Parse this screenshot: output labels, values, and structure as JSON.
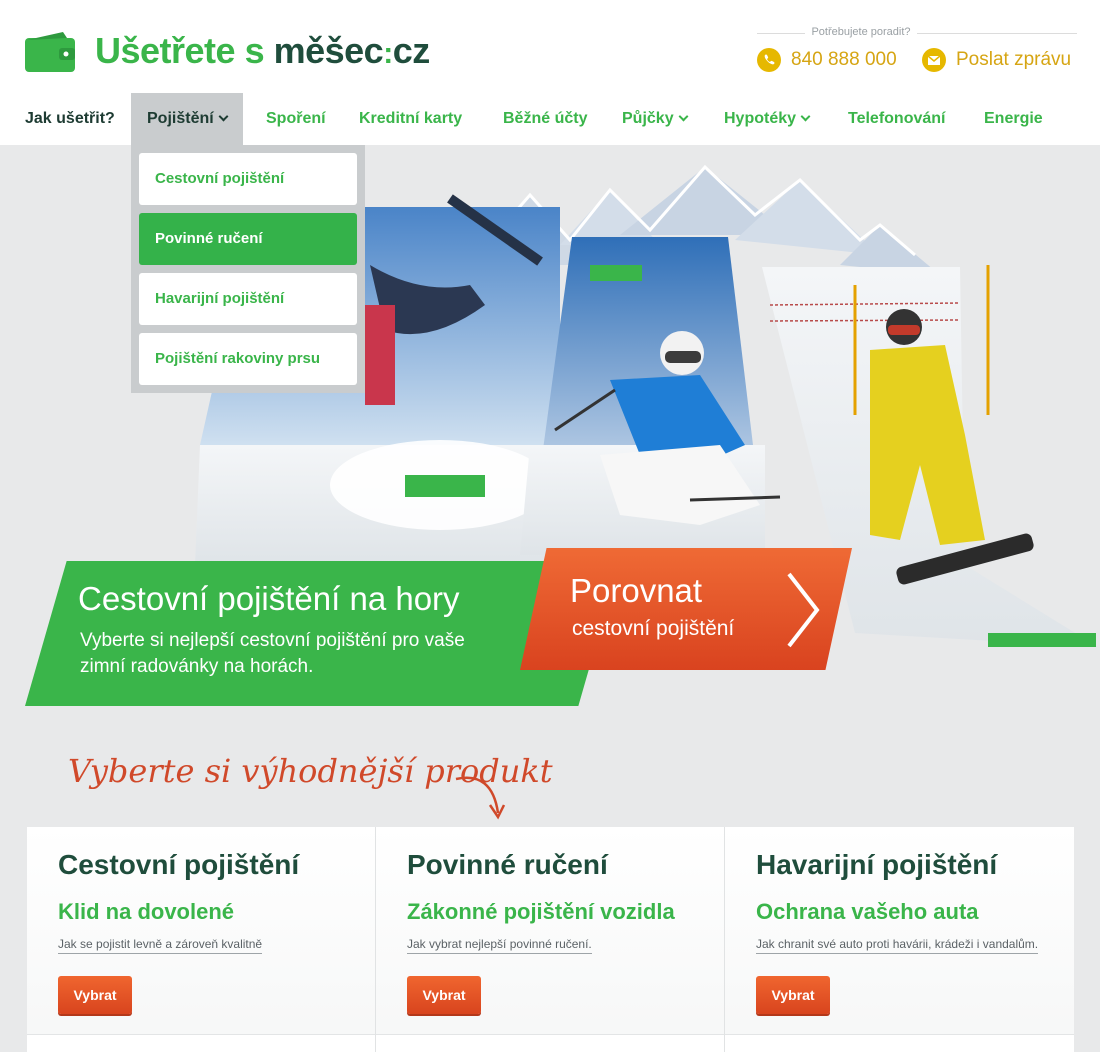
{
  "logo": {
    "part1": "Ušetřete s ",
    "part2": "měšec",
    "dots": ":",
    "part3": "cz"
  },
  "help": {
    "label": "Potřebujete poradit?",
    "phone": "840 888 000",
    "message": "Poslat zprávu"
  },
  "nav": {
    "items": [
      {
        "label": "Jak ušetřit?"
      },
      {
        "label": "Pojištění"
      },
      {
        "label": "Spoření"
      },
      {
        "label": "Kreditní karty"
      },
      {
        "label": "Běžné účty"
      },
      {
        "label": "Půjčky"
      },
      {
        "label": "Hypotéky"
      },
      {
        "label": "Telefonování"
      },
      {
        "label": "Energie"
      }
    ]
  },
  "dropdown": {
    "items": [
      {
        "label": "Cestovní pojištění"
      },
      {
        "label": "Povinné ručení"
      },
      {
        "label": "Havarijní pojištění"
      },
      {
        "label": "Pojištění rakoviny prsu"
      }
    ]
  },
  "hero": {
    "title": "Cestovní pojištění na hory",
    "subtitle": "Vyberte si nejlepší cestovní pojištění pro vaše zimní radovánky na horách.",
    "cta_big": "Porovnat",
    "cta_small": "cestovní pojištění"
  },
  "section": {
    "headline": "Vyberte si výhodnější produkt"
  },
  "cards": [
    {
      "title": "Cestovní pojištění",
      "subtitle": "Klid na dovolené",
      "link": "Jak se pojistit levně a zároveň kvalitně",
      "button": "Vybrat"
    },
    {
      "title": "Povinné ručení",
      "subtitle": "Zákonné pojištění vozidla",
      "link": "Jak vybrat nejlepší povinné ručení.",
      "button": "Vybrat"
    },
    {
      "title": "Havarijní pojištění",
      "subtitle": "Ochrana vašeho auta",
      "link": "Jak chranit své auto proti havárii, krádeži i vandalům.",
      "button": "Vybrat"
    }
  ],
  "colors": {
    "brand_green": "#3ab54a",
    "brand_dark": "#1f4d3c",
    "accent_orange": "#e4532a",
    "accent_yellow": "#e6b800"
  }
}
